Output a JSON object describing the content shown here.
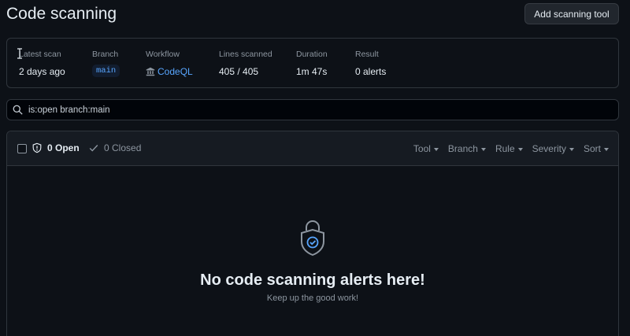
{
  "header": {
    "title": "Code scanning",
    "add_tool_label": "Add scanning tool"
  },
  "scan_summary": {
    "latest_scan": {
      "label": "Latest scan",
      "value": "2 days ago"
    },
    "branch": {
      "label": "Branch",
      "value": "main"
    },
    "workflow": {
      "label": "Workflow",
      "value": "CodeQL",
      "icon": "bank-icon"
    },
    "lines_scanned": {
      "label": "Lines scanned",
      "value": "405 / 405"
    },
    "duration": {
      "label": "Duration",
      "value": "1m 47s"
    },
    "result": {
      "label": "Result",
      "value": "0 alerts"
    }
  },
  "search": {
    "value": "is:open branch:main",
    "icon": "search-icon"
  },
  "alerts": {
    "open_label": "0 Open",
    "closed_label": "0 Closed",
    "filters": [
      "Tool",
      "Branch",
      "Rule",
      "Severity",
      "Sort"
    ],
    "empty_title": "No code scanning alerts here!",
    "empty_subtitle": "Keep up the good work!"
  },
  "colors": {
    "background": "#0d1117",
    "accent": "#58a6ff",
    "border": "#30363d",
    "muted": "#8d96a0"
  }
}
